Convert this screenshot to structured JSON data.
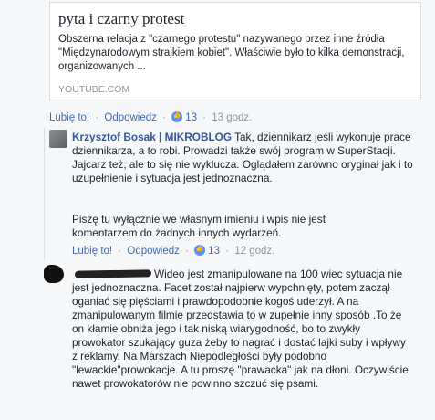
{
  "preview": {
    "title": "pyta i czarny protest",
    "description": "Obszerna relacja z \"czarnego protestu\" nazywanego przez inne źródła \"Międzynarodowym strajkiem kobiet\". Właściwie było to kilka demonstracji, organizowanych ...",
    "source": "YOUTUBE.COM"
  },
  "comment1_actions": {
    "like": "Lubię to!",
    "reply": "Odpowiedz",
    "count": "13",
    "time": "13 godz."
  },
  "reply1": {
    "author": "Krzysztof Bosak | MIKROBLOG",
    "text_p1": " Tak, dziennikarz jeśli wykonuje prace dziennikarza, a to robi. Prowadzi także swój program w SuperStacji. Jajcarz też, ale to się nie wyklucza. Oglądałem zarówno oryginał jak i to uzupełnienie i sytuacja jest jednoznaczna.",
    "text_p2": "Piszę tu wyłącznie we własnym imieniu i wpis nie jest komentarzem do żadnych innych wydarzeń.",
    "actions": {
      "like": "Lubię to!",
      "reply": "Odpowiedz",
      "count": "13",
      "time": "12 godz."
    }
  },
  "reply2": {
    "text": "Wideo jest zmanipulowane na 100 wiec sytuacja nie jest jednoznaczna. Facet został najpierw wypchnięty, potem zaczął oganiać się pięściami i prawdopodobnie kogoś uderzył. A na zmanipulowanym filmie przedstawia to w zupełnie inny sposób .To że on kłamie obniża jego i tak niską wiarygodność, bo to zwykły prowokator szukający guza żeby to nagrać i dostać lajki suby i wpływy z reklamy. Na Marszach Niepodległości były podobno \"lewackie\"prowokacje. A tu proszę \"prawacka\" jak na dłoni. Oczywiście nawet prowokatorów nie powinno szczuć się psami."
  }
}
